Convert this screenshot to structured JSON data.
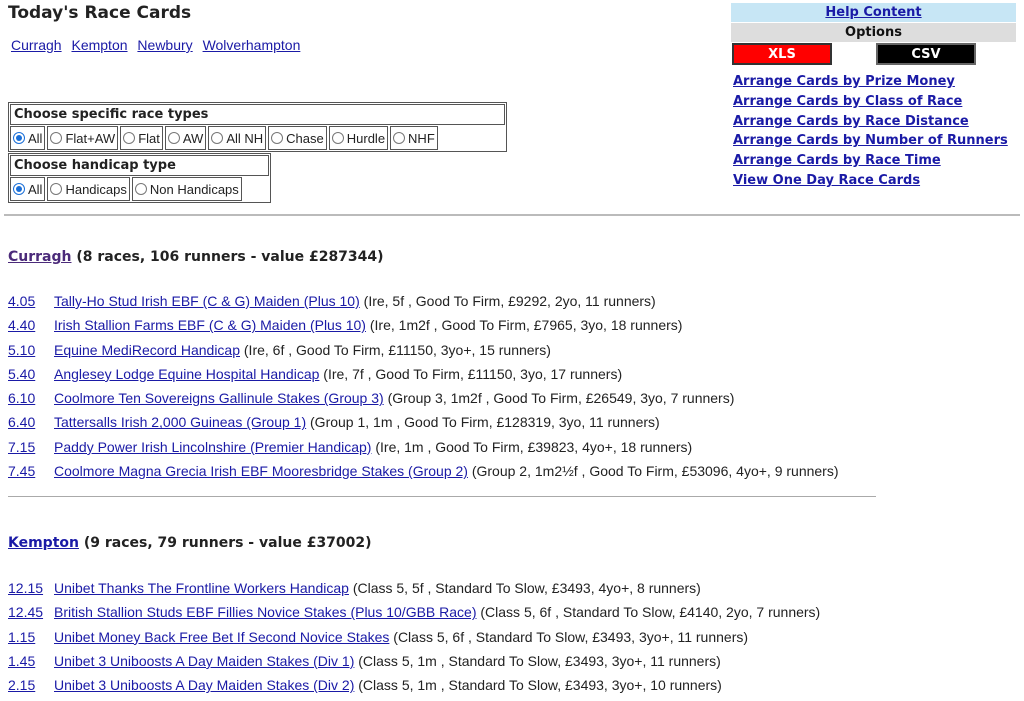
{
  "page": {
    "title": "Today's Race Cards"
  },
  "courses": [
    "Curragh",
    "Kempton",
    "Newbury",
    "Wolverhampton"
  ],
  "race_type_filter": {
    "heading": "Choose specific race types",
    "options": [
      "All",
      "Flat+AW",
      "Flat",
      "AW",
      "All NH",
      "Chase",
      "Hurdle",
      "NHF"
    ],
    "selected": "All"
  },
  "handicap_filter": {
    "heading": "Choose handicap type",
    "options": [
      "All",
      "Handicaps",
      "Non Handicaps"
    ],
    "selected": "All"
  },
  "side_panel": {
    "help": "Help Content",
    "options_label": "Options",
    "xls": "XLS",
    "csv": "CSV",
    "links": [
      "Arrange Cards by Prize Money",
      "Arrange Cards by Class of Race",
      "Arrange Cards by Race Distance",
      "Arrange Cards by Number of Runners",
      "Arrange Cards by Race Time",
      "View One Day Race Cards"
    ]
  },
  "meetings": [
    {
      "name": "Curragh",
      "summary": " (8 races, 106 runners - value £287344)",
      "races": [
        {
          "time": "4.05",
          "name": "Tally-Ho Stud Irish EBF (C & G) Maiden (Plus 10)",
          "details": " (Ire, 5f , Good To Firm, £9292, 2yo, 11 runners)"
        },
        {
          "time": "4.40",
          "name": "Irish Stallion Farms EBF (C & G) Maiden (Plus 10)",
          "details": " (Ire, 1m2f , Good To Firm, £7965, 3yo, 18 runners)"
        },
        {
          "time": "5.10",
          "name": "Equine MediRecord Handicap",
          "details": " (Ire, 6f , Good To Firm, £11150, 3yo+, 15 runners)"
        },
        {
          "time": "5.40",
          "name": "Anglesey Lodge Equine Hospital Handicap",
          "details": " (Ire, 7f , Good To Firm, £11150, 3yo, 17 runners)"
        },
        {
          "time": "6.10",
          "name": "Coolmore Ten Sovereigns Gallinule Stakes (Group 3)",
          "details": " (Group 3, 1m2f , Good To Firm, £26549, 3yo, 7 runners)"
        },
        {
          "time": "6.40",
          "name": "Tattersalls Irish 2,000 Guineas (Group 1)",
          "details": " (Group 1, 1m , Good To Firm, £128319, 3yo, 11 runners)"
        },
        {
          "time": "7.15",
          "name": "Paddy Power Irish Lincolnshire (Premier Handicap)",
          "details": " (Ire, 1m , Good To Firm, £39823, 4yo+, 18 runners)"
        },
        {
          "time": "7.45",
          "name": "Coolmore Magna Grecia Irish EBF Mooresbridge Stakes (Group 2)",
          "details": " (Group 2, 1m2½f , Good To Firm, £53096, 4yo+, 9 runners)"
        }
      ]
    },
    {
      "name": "Kempton",
      "summary": " (9 races, 79 runners - value £37002)",
      "races": [
        {
          "time": "12.15",
          "name": "Unibet Thanks The Frontline Workers Handicap",
          "details": " (Class 5, 5f , Standard To Slow, £3493, 4yo+, 8 runners)"
        },
        {
          "time": "12.45",
          "name": "British Stallion Studs EBF Fillies Novice Stakes (Plus 10/GBB Race)",
          "details": " (Class 5, 6f , Standard To Slow, £4140, 2yo, 7 runners)"
        },
        {
          "time": "1.15",
          "name": "Unibet Money Back Free Bet If Second Novice Stakes",
          "details": " (Class 5, 6f , Standard To Slow, £3493, 3yo+, 11 runners)"
        },
        {
          "time": "1.45",
          "name": "Unibet 3 Uniboosts A Day Maiden Stakes (Div 1)",
          "details": " (Class 5, 1m , Standard To Slow, £3493, 3yo+, 11 runners)"
        },
        {
          "time": "2.15",
          "name": "Unibet 3 Uniboosts A Day Maiden Stakes (Div 2)",
          "details": " (Class 5, 1m , Standard To Slow, £3493, 3yo+, 10 runners)"
        }
      ]
    }
  ]
}
